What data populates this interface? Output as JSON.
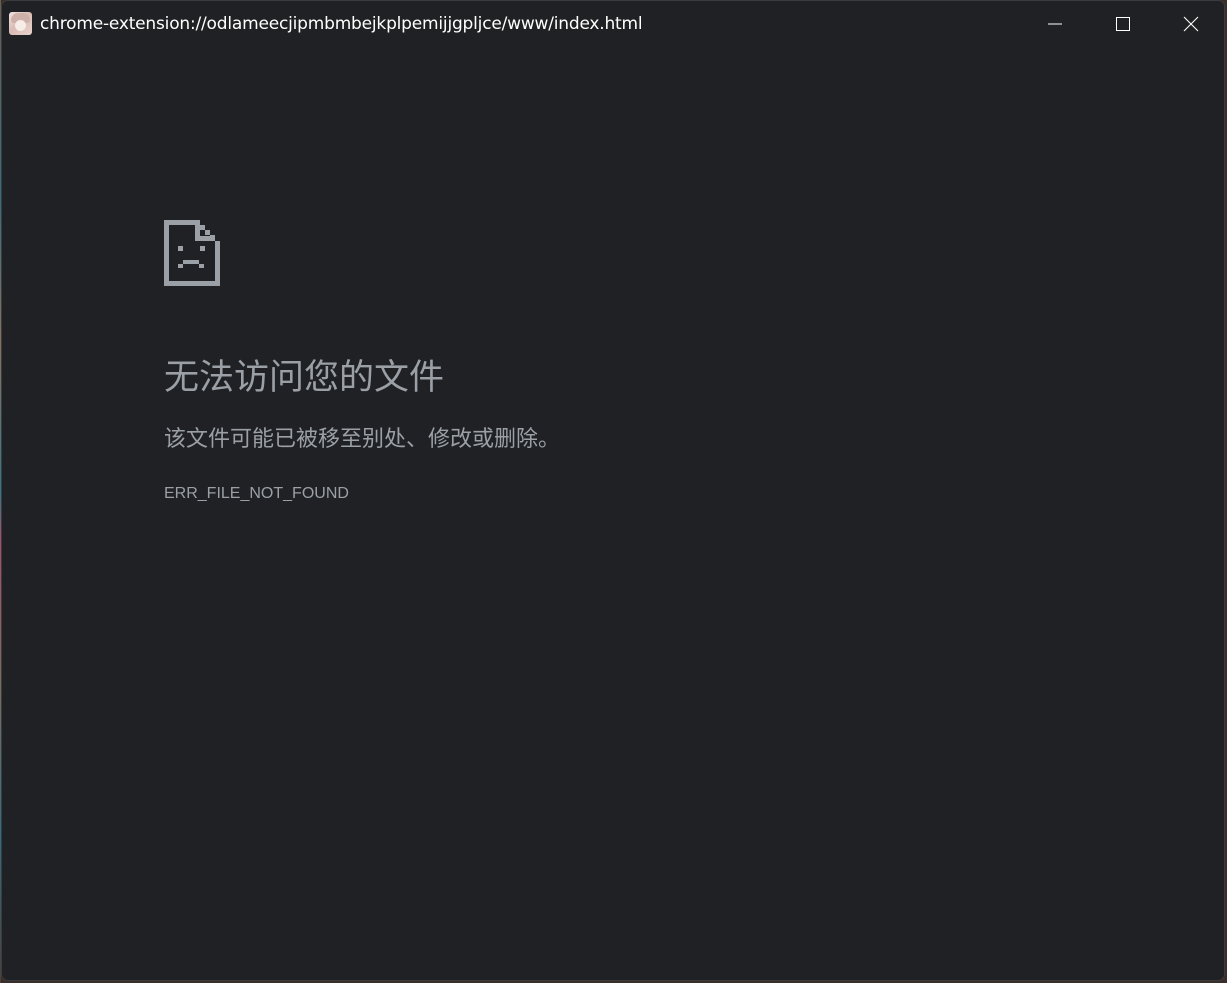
{
  "window": {
    "title": "chrome-extension://odlameecjipmbmbejkplpemijjgpljce/www/index.html",
    "icon": "app-avatar-icon",
    "controls": {
      "minimize": "minimize-icon",
      "maximize": "maximize-icon",
      "close": "close-icon"
    }
  },
  "error_page": {
    "icon": "sad-file-icon",
    "heading": "无法访问您的文件",
    "description": "该文件可能已被移至别处、修改或删除。",
    "error_code": "ERR_FILE_NOT_FOUND"
  },
  "colors": {
    "background": "#202124",
    "text": "#9aa0a6",
    "title_text": "#ffffff",
    "icon": "#9aa0a6"
  }
}
